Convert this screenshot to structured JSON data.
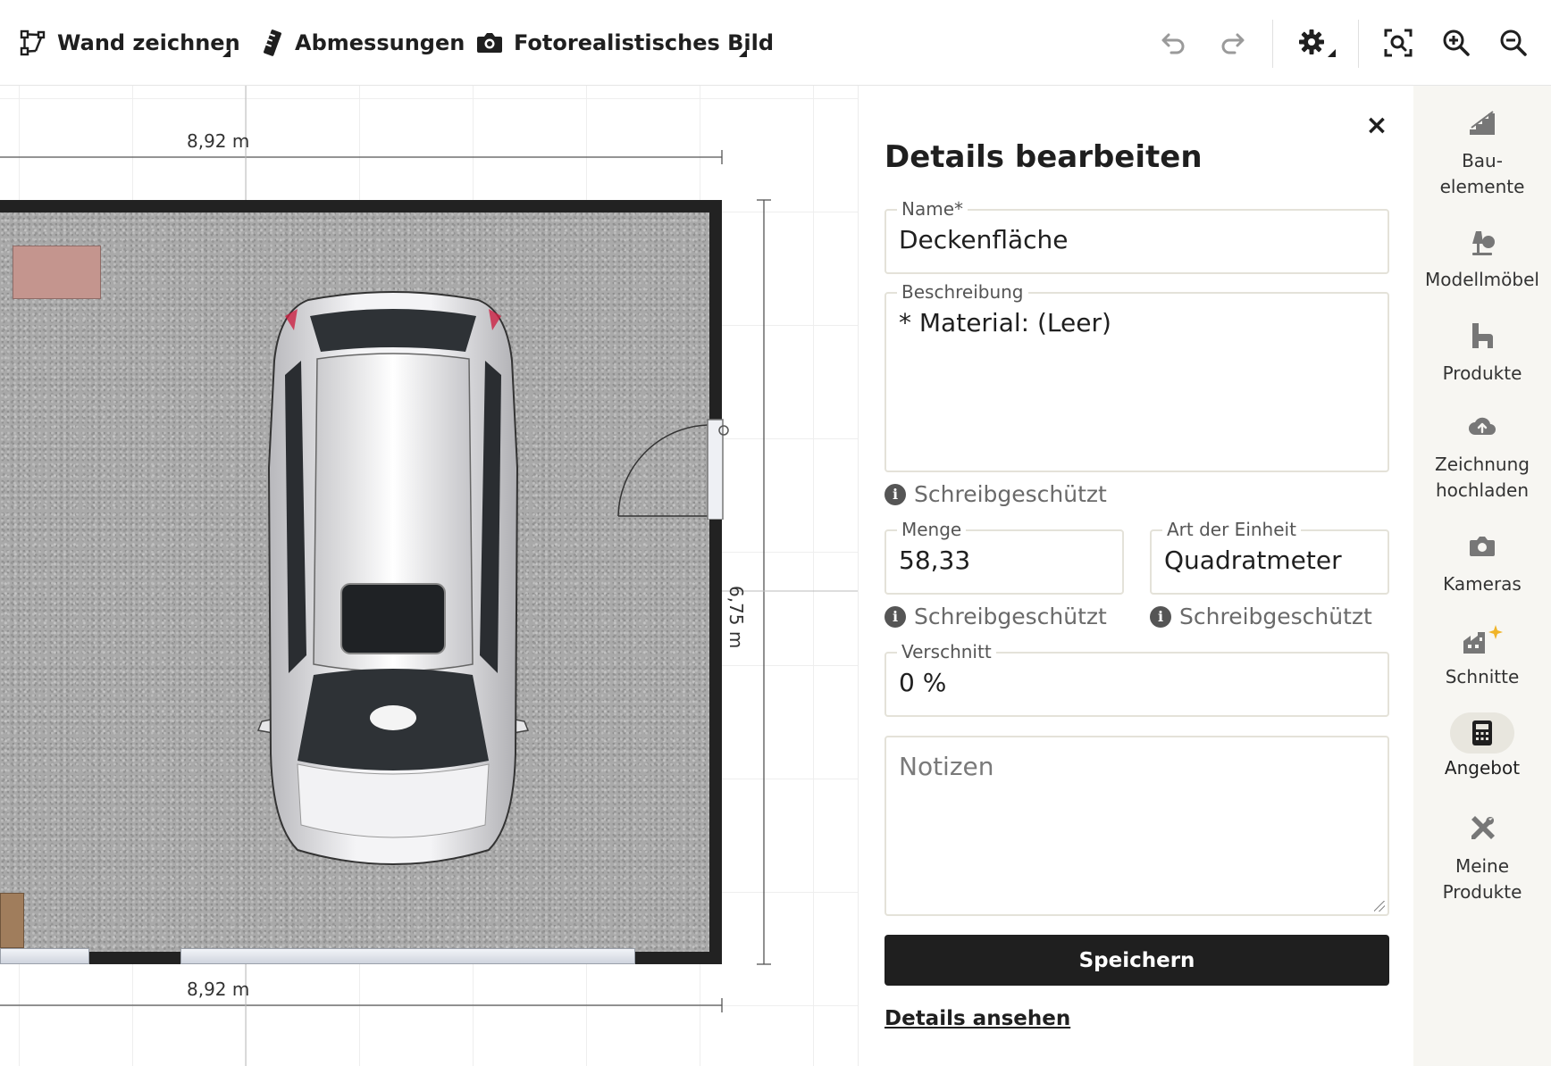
{
  "toolbar": {
    "draw_wall": "Wand zeichnen",
    "dimensions": "Abmessungen",
    "photo_image": "Fotorealistisches Bild"
  },
  "canvas": {
    "dim_top": "8,92 m",
    "dim_bottom": "8,92 m",
    "dim_right": "6,75 m"
  },
  "panel": {
    "title": "Details bearbeiten",
    "close": "×",
    "name_label": "Name*",
    "name_value": "Deckenfläche",
    "desc_label": "Beschreibung",
    "desc_value": "* Material: (Leer)",
    "readonly_text": "Schreibgeschützt",
    "qty_label": "Menge",
    "qty_value": "58,33",
    "unit_label": "Art der Einheit",
    "unit_value": "Quadratmeter",
    "waste_label": "Verschnitt",
    "waste_value": "0 %",
    "notes_placeholder": "Notizen",
    "save": "Speichern",
    "details_link": "Details ansehen"
  },
  "sidebar": {
    "items": [
      {
        "label": "Bau-\nelemente",
        "icon": "stairs-icon"
      },
      {
        "label": "Modellmöbel",
        "icon": "lamp-icon"
      },
      {
        "label": "Produkte",
        "icon": "chair-icon"
      },
      {
        "label": "Zeichnung\nhochladen",
        "icon": "cloud-upload-icon"
      },
      {
        "label": "Kameras",
        "icon": "camera-icon"
      },
      {
        "label": "Schnitte",
        "icon": "buildings-sparkle-icon"
      },
      {
        "label": "Angebot",
        "icon": "calculator-icon"
      },
      {
        "label": "Meine\nProdukte",
        "icon": "tools-icon"
      }
    ],
    "active": "Angebot"
  }
}
